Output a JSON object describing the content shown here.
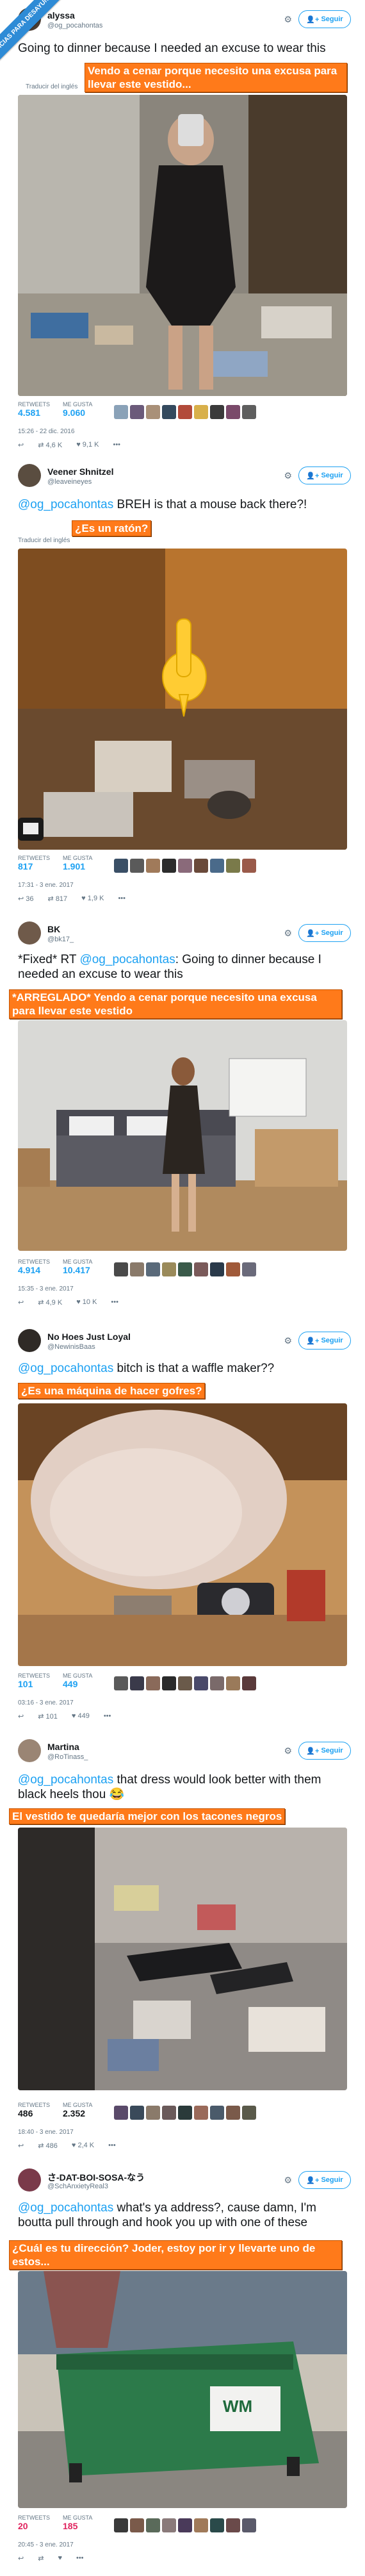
{
  "ribbon": "NOTICIAS PARA DESAYUNAR",
  "follow_label": "Seguir",
  "translate_label": "Traducir del inglés",
  "retweets_label": "RETWEETS",
  "likes_label": "ME GUSTA",
  "tweets": [
    {
      "name": "alyssa",
      "handle": "@og_pocahontas",
      "text": "Going to dinner because I needed an excuse to wear this",
      "caption": "Vendo a cenar porque necesito una excusa para llevar este vestido...",
      "retweets": "4.581",
      "likes": "9.060",
      "date": "15:26 - 22 dic. 2016",
      "reply": "",
      "rt": "4,6 K",
      "fav": "9,1 K"
    },
    {
      "name": "Veener Shnitzel",
      "handle": "@leaveineyes",
      "mention": "@og_pocahontas",
      "text": " BREH is that a mouse back there?!",
      "caption": "¿Es un ratón?",
      "retweets": "817",
      "likes": "1.901",
      "date": "17:31 - 3 ene. 2017",
      "reply": "36",
      "rt": "817",
      "fav": "1,9 K"
    },
    {
      "name": "BK",
      "handle": "@bk17_",
      "text_pre": "*Fixed* RT ",
      "mention": "@og_pocahontas",
      "text": ": Going to dinner because I needed an excuse to wear this",
      "caption": "*ARREGLADO* Yendo a cenar porque necesito una excusa para llevar este vestido",
      "retweets": "4.914",
      "likes": "10.417",
      "date": "15:35 - 3 ene. 2017",
      "reply": "",
      "rt": "4,9 K",
      "fav": "10 K"
    },
    {
      "name": "No Hoes Just Loyal",
      "handle": "@NewinisBaas",
      "mention": "@og_pocahontas",
      "text": " bitch is that a waffle maker??",
      "caption": "¿Es una máquina de hacer gofres?",
      "retweets": "101",
      "likes": "449",
      "date": "03:16 - 3 ene. 2017",
      "reply": "",
      "rt": "101",
      "fav": "449"
    },
    {
      "name": "Martina",
      "handle": "@RoTinass_",
      "mention": "@og_pocahontas",
      "text": " that dress would look better with them black heels thou 😂",
      "caption": "El vestido te quedaría mejor con los tacones negros",
      "retweets": "486",
      "likes": "2.352",
      "date": "18:40 - 3 ene. 2017",
      "reply": "",
      "rt": "486",
      "fav": "2,4 K"
    },
    {
      "name": "さ-DAT-BOI-SOSA-なう",
      "handle": "@SchAnxietyReal3",
      "mention": "@og_pocahontas",
      "text": " what's ya address?, cause damn, I'm boutta pull through and hook you up with one of these",
      "caption": "¿Cuál es tu dirección? Joder, estoy por ir y llevarte uno de estos...",
      "retweets": "20",
      "likes": "185",
      "date": "20:45 - 3 ene. 2017",
      "reply": "",
      "rt": "",
      "fav": ""
    }
  ],
  "colors": {
    "accent": "#1da1f2",
    "caption_bg": "#ff7a1a",
    "ribbon": "#2e8bd6"
  }
}
